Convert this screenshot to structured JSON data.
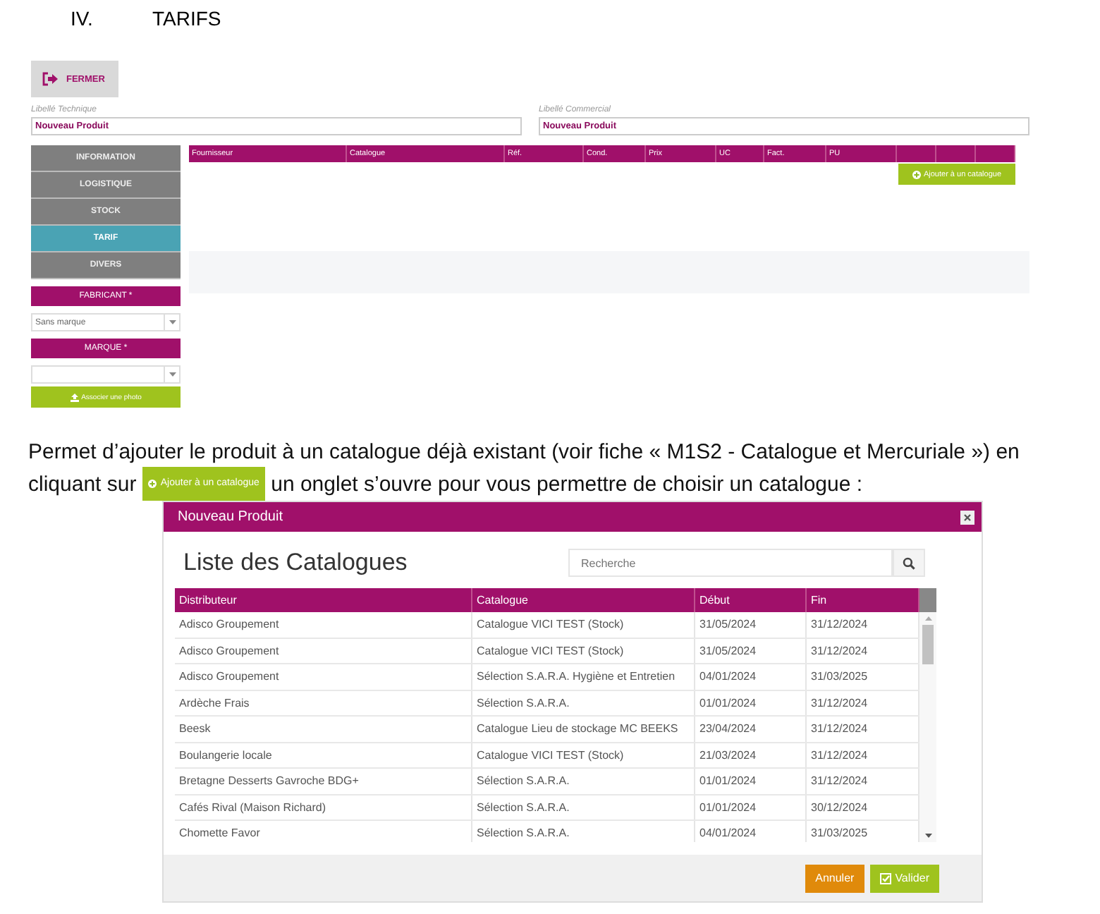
{
  "heading": {
    "number": "IV.",
    "title": "TARIFS"
  },
  "product_form": {
    "close_button": "FERMER",
    "fields": [
      {
        "label": "Libellé Technique",
        "value": "Nouveau Produit"
      },
      {
        "label": "Libellé Commercial",
        "value": "Nouveau Produit"
      }
    ],
    "tabs": [
      {
        "label": "INFORMATION",
        "selected": false
      },
      {
        "label": "LOGISTIQUE",
        "selected": false
      },
      {
        "label": "STOCK",
        "selected": false
      },
      {
        "label": "TARIF",
        "selected": true
      },
      {
        "label": "DIVERS",
        "selected": false
      }
    ],
    "fabricant": {
      "label": "FABRICANT *",
      "value": "Sans marque"
    },
    "marque": {
      "label": "MARQUE *"
    },
    "photo_button": "Associer une photo",
    "table": {
      "columns": [
        "Fournisseur",
        "Catalogue",
        "Réf.",
        "Cond.",
        "Prix",
        "UC",
        "Fact.",
        "PU"
      ]
    },
    "add_button": "Ajouter à un catalogue"
  },
  "paragraph": {
    "text_before": "Permet d’ajouter le produit à un catalogue déjà existant (voir fiche « M1S2 - Catalogue et Mercuriale ») en cliquant sur",
    "inline_button": "Ajouter à un catalogue",
    "text_after": "un onglet s’ouvre pour vous permettre de choisir un catalogue :"
  },
  "dialog": {
    "title": "Nouveau Produit",
    "heading": "Liste des Catalogues",
    "search": {
      "placeholder": "Recherche"
    },
    "columns": [
      "Distributeur",
      "Catalogue",
      "Début",
      "Fin"
    ],
    "rows": [
      [
        "Adisco Groupement",
        "Catalogue VICI TEST (Stock)",
        "31/05/2024",
        "31/12/2024"
      ],
      [
        "Adisco Groupement",
        "Catalogue VICI TEST (Stock)",
        "31/05/2024",
        "31/12/2024"
      ],
      [
        "Adisco Groupement",
        "Sélection S.A.R.A. Hygiène et Entretien",
        "04/01/2024",
        "31/03/2025"
      ],
      [
        "Ardèche Frais",
        "Sélection S.A.R.A.",
        "01/01/2024",
        "31/12/2024"
      ],
      [
        "Beesk",
        "Catalogue Lieu de stockage MC BEEKS",
        "23/04/2024",
        "31/12/2024"
      ],
      [
        "Boulangerie locale",
        "Catalogue VICI TEST (Stock)",
        "21/03/2024",
        "31/12/2024"
      ],
      [
        "Bretagne Desserts Gavroche BDG+",
        "Sélection S.A.R.A.",
        "01/01/2024",
        "31/12/2024"
      ],
      [
        "Cafés Rival (Maison Richard)",
        "Sélection S.A.R.A.",
        "01/01/2024",
        "30/12/2024"
      ],
      [
        "Chomette Favor",
        "Sélection S.A.R.A.",
        "04/01/2024",
        "31/03/2025"
      ]
    ],
    "buttons": [
      {
        "label": "Annuler",
        "kind": "cancel"
      },
      {
        "label": "Valider",
        "kind": "confirm"
      }
    ]
  }
}
